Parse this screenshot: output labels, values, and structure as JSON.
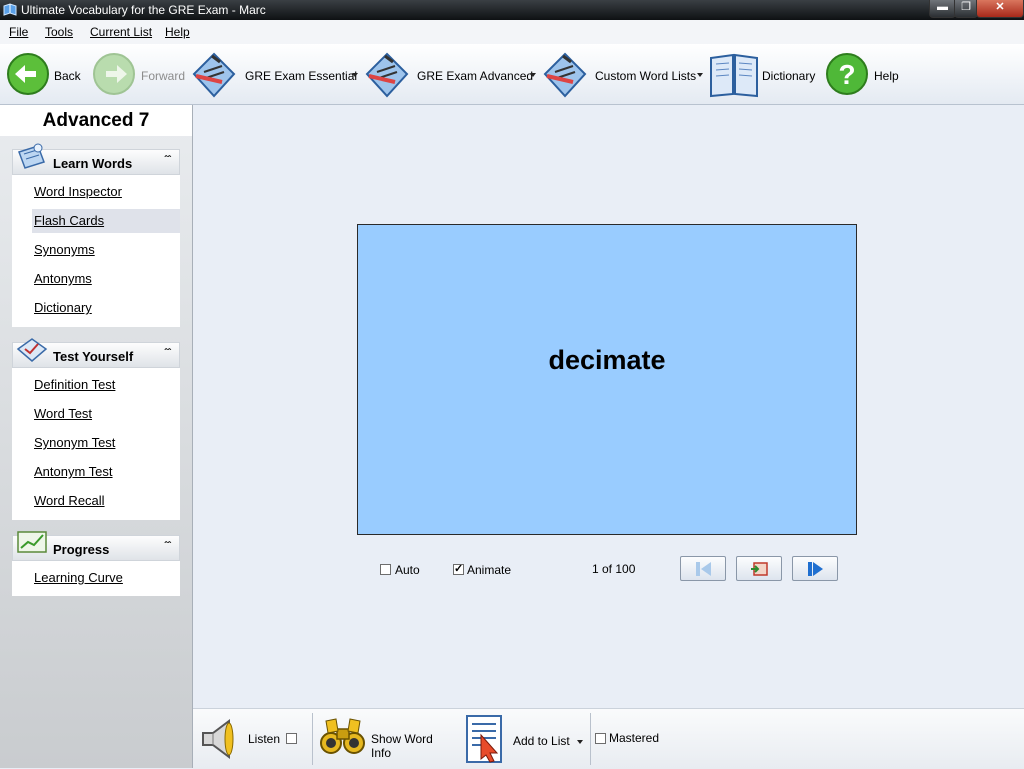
{
  "window": {
    "title": "Ultimate Vocabulary for the GRE Exam - Marc"
  },
  "menu": {
    "file": "File",
    "tools": "Tools",
    "current_list": "Current List",
    "help": "Help"
  },
  "toolbar": {
    "back": "Back",
    "forward": "Forward",
    "gre_essential": "GRE Exam Essential",
    "gre_advanced": "GRE Exam Advanced",
    "custom_lists": "Custom Word Lists",
    "dictionary": "Dictionary",
    "help": "Help"
  },
  "sidebar": {
    "list_title": "Advanced 7",
    "learn": {
      "header": "Learn Words",
      "items": [
        "Word Inspector",
        "Flash Cards",
        "Synonyms",
        "Antonyms",
        "Dictionary"
      ],
      "selected": "Flash Cards"
    },
    "test": {
      "header": "Test Yourself",
      "items": [
        "Definition Test",
        "Word Test",
        "Synonym Test",
        "Antonym Test",
        "Word Recall"
      ]
    },
    "progress": {
      "header": "Progress",
      "items": [
        "Learning Curve"
      ]
    }
  },
  "card": {
    "word": "decimate",
    "background": "#99ccff"
  },
  "controls": {
    "auto_label": "Auto",
    "auto_checked": false,
    "animate_label": "Animate",
    "animate_checked": true,
    "counter": "1 of 100"
  },
  "bottom": {
    "listen": "Listen",
    "listen_checked": false,
    "show_word_info": "Show Word Info",
    "add_to_list": "Add to List",
    "mastered": "Mastered",
    "mastered_checked": false
  }
}
